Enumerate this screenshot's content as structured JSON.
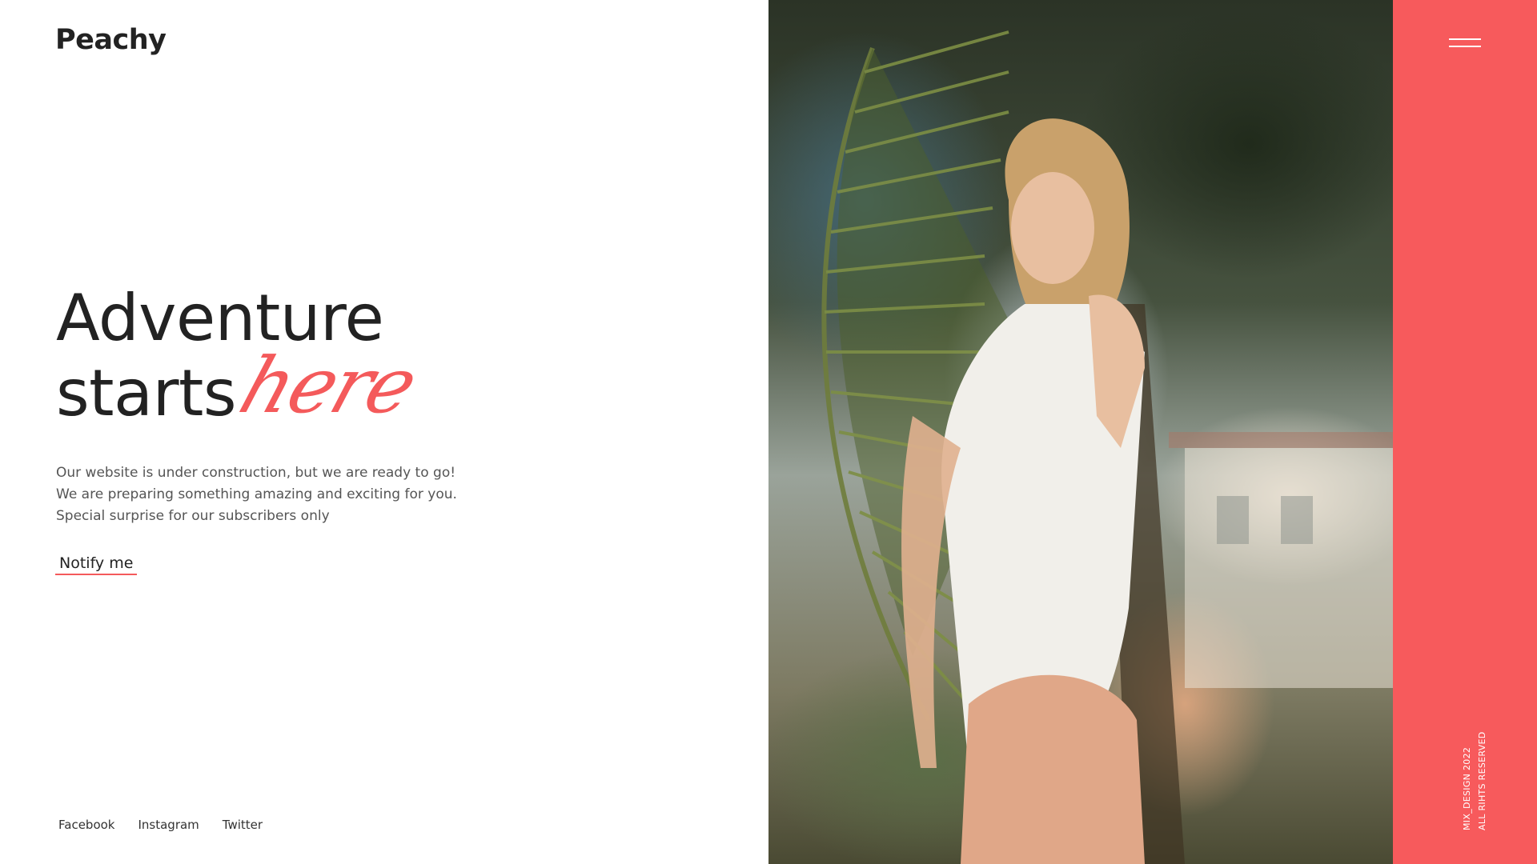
{
  "brand": {
    "logo": "Peachy"
  },
  "hero": {
    "line1": "Adventure",
    "line2": "starts",
    "script_word": "here",
    "description": "Our website is under construction, but we are ready to go! We are preparing something amazing and exciting for you. Special surprise for our subscribers only",
    "cta_label": "Notify me"
  },
  "social": [
    "Facebook",
    "Instagram",
    "Twitter"
  ],
  "sidebar": {
    "menu_icon": "hamburger-menu-icon",
    "copyright_line1": "MIX_DESIGN 2022",
    "copyright_line2": "ALL RIHTS RESERVED"
  },
  "colors": {
    "accent": "#f45a5b",
    "sidebar_bg": "#f75a5c",
    "text_dark": "#222222",
    "text_body": "#555555"
  }
}
